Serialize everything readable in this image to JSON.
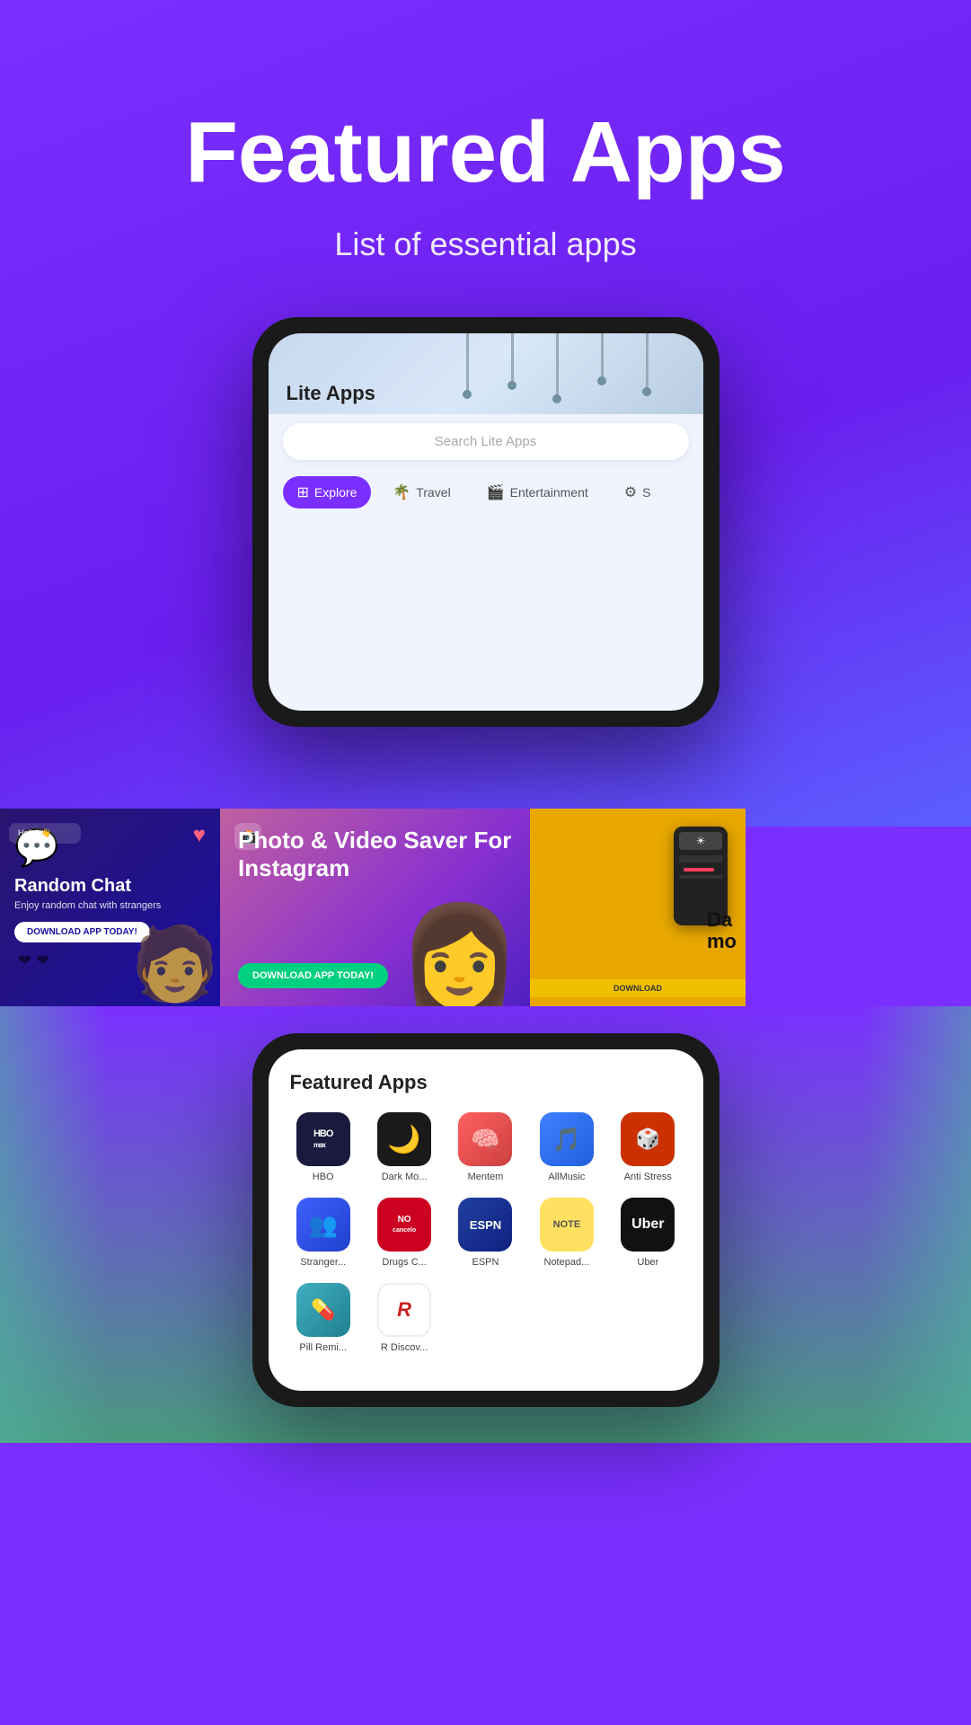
{
  "hero": {
    "title": "Featured Apps",
    "subtitle": "List of essential apps"
  },
  "phone": {
    "screen_title": "Lite Apps",
    "search_placeholder": "Search Lite Apps",
    "tabs": [
      {
        "label": "Explore",
        "icon": "⊞",
        "active": true
      },
      {
        "label": "Travel",
        "icon": "🌴",
        "active": false
      },
      {
        "label": "Entertainment",
        "icon": "🎬",
        "active": false
      },
      {
        "label": "S...",
        "icon": "⚙",
        "active": false
      }
    ]
  },
  "banners": [
    {
      "title": "Random Chat",
      "subtitle": "Enjoy random chat with strangers",
      "button": "DOWNLOAD APP TODAY!",
      "bg": "blue"
    },
    {
      "title": "Photo & Video Saver For Instagram",
      "button": "DOWNLOAD APP TODAY!",
      "bg": "purple"
    },
    {
      "title": "Da mo",
      "button": "DOWNLOAD",
      "bg": "yellow"
    }
  ],
  "featured": {
    "section_title": "Featured Apps",
    "apps": [
      {
        "name": "HBO",
        "label": "HBO",
        "icon_type": "hbo"
      },
      {
        "name": "Dark Mode",
        "label": "Dark Mo...",
        "icon_type": "dark"
      },
      {
        "name": "Mentem",
        "label": "Mentem",
        "icon_type": "mentem"
      },
      {
        "name": "AllMusic",
        "label": "AllMusic",
        "icon_type": "allmusic"
      },
      {
        "name": "Anti Stress",
        "label": "Anti Stress",
        "icon_type": "antistress"
      },
      {
        "name": "Strangers",
        "label": "Stranger...",
        "icon_type": "stranger"
      },
      {
        "name": "Drugs Check",
        "label": "Drugs C...",
        "icon_type": "drugs"
      },
      {
        "name": "ESPN",
        "label": "ESPN",
        "icon_type": "espn"
      },
      {
        "name": "Notepad",
        "label": "Notepad...",
        "icon_type": "notepad"
      },
      {
        "name": "Uber",
        "label": "Uber",
        "icon_type": "uber"
      },
      {
        "name": "Pill Reminder",
        "label": "Pill Remi...",
        "icon_type": "pill"
      },
      {
        "name": "R Discovery",
        "label": "R Discov...",
        "icon_type": "rdiscov"
      }
    ]
  }
}
